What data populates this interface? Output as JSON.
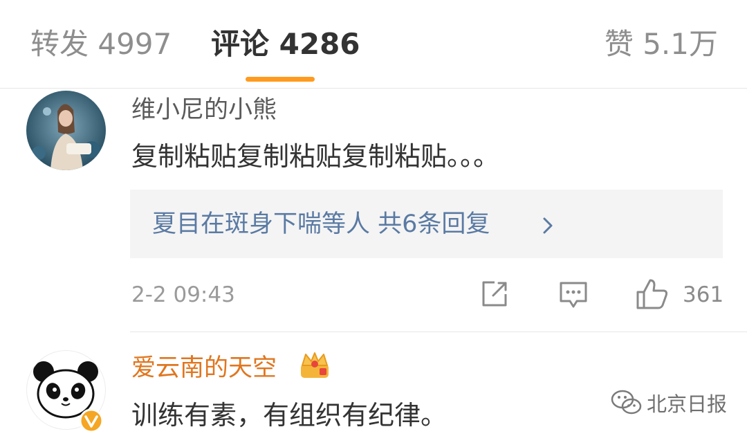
{
  "tabs": {
    "repost": "转发 4997",
    "comments": "评论 4286",
    "likes": "赞 5.1万",
    "active": "comments",
    "indicator_color": "#ff9a1f"
  },
  "comments": [
    {
      "username": "维小尼的小熊",
      "text": "复制粘贴复制粘贴复制粘贴。。。",
      "reply_preview": "夏目在斑身下喘等人 共6条回复",
      "timestamp": "2-2 09:43",
      "like_count": "361",
      "action_icons": [
        "share-icon",
        "comment-icon",
        "like-icon"
      ]
    },
    {
      "username": "爱云南的天空",
      "username_color": "#e0761f",
      "badge": "crown-icon",
      "verified": true,
      "text": "训练有素，有组织有纪律。"
    }
  ],
  "watermark": {
    "text": "北京日报",
    "icon": "wechat-icon"
  }
}
